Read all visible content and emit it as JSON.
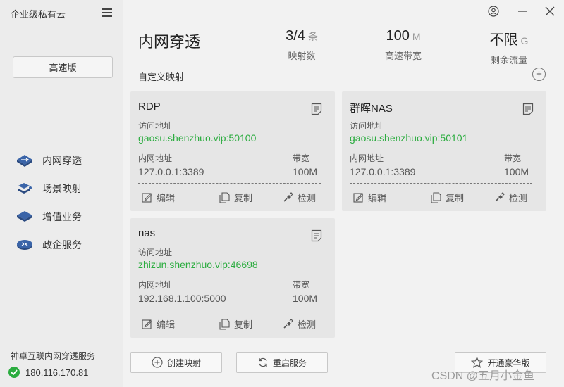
{
  "app": {
    "title": "企业级私有云"
  },
  "sidebar": {
    "edition_button": "高速版",
    "nav": [
      {
        "label": "内网穿透",
        "icon": "network-penetration-icon"
      },
      {
        "label": "场景映射",
        "icon": "scene-mapping-icon"
      },
      {
        "label": "增值业务",
        "icon": "value-added-icon"
      },
      {
        "label": "政企服务",
        "icon": "enterprise-router-icon"
      }
    ],
    "service_label": "神卓互联内网穿透服务",
    "ip": "180.116.170.81"
  },
  "header": {
    "title": "内网穿透",
    "stats": [
      {
        "value": "3/4",
        "unit": "条",
        "label": "映射数"
      },
      {
        "value": "100",
        "unit": "M",
        "label": "高速带宽"
      },
      {
        "value": "不限",
        "unit": "G",
        "label": "剩余流量"
      }
    ],
    "section_title": "自定义映射"
  },
  "labels": {
    "access_addr": "访问地址",
    "lan_addr": "内网地址",
    "bandwidth": "带宽",
    "edit": "编辑",
    "copy": "复制",
    "detect": "检测"
  },
  "cards": [
    {
      "name": "RDP",
      "access": "gaosu.shenzhuo.vip:50100",
      "lan": "127.0.0.1:3389",
      "bw": "100M"
    },
    {
      "name": "群晖NAS",
      "access": "gaosu.shenzhuo.vip:50101",
      "lan": "127.0.0.1:3389",
      "bw": "100M"
    },
    {
      "name": "nas",
      "access": "zhizun.shenzhuo.vip:46698",
      "lan": "192.168.1.100:5000",
      "bw": "100M"
    }
  ],
  "footer": {
    "create": "创建映射",
    "restart": "重启服务",
    "upgrade": "开通豪华版"
  },
  "watermark": "CSDN @五月小金鱼",
  "colors": {
    "accent_green": "#2bac3f",
    "card_bg": "#e6e6e6",
    "sidebar_bg": "#ececec"
  }
}
